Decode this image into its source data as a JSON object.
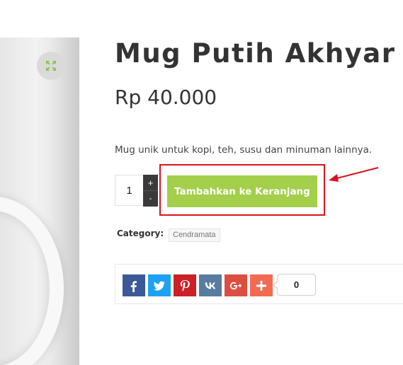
{
  "product": {
    "title": "Mug Putih Akhyar",
    "price": "Rp 40.000",
    "description": "Mug unik untuk kopi, teh, susu dan minuman lainnya.",
    "zoom_icon": "expand-icon"
  },
  "cart": {
    "quantity": "1",
    "increment_label": "+",
    "decrement_label": "-",
    "add_to_cart_label": "Tambahkan ke Keranjang"
  },
  "meta": {
    "category_label": "Category:",
    "category_value": "Cendramata"
  },
  "share": {
    "buttons": [
      {
        "network": "facebook",
        "icon": "facebook-icon",
        "color": "#3b5998"
      },
      {
        "network": "twitter",
        "icon": "twitter-icon",
        "color": "#1da1f2"
      },
      {
        "network": "pinterest",
        "icon": "pinterest-icon",
        "color": "#cb2027"
      },
      {
        "network": "vk",
        "icon": "vk-icon",
        "color": "#587ba0"
      },
      {
        "network": "google-plus",
        "icon": "google-plus-icon",
        "color": "#dc4e41"
      },
      {
        "network": "addthis",
        "icon": "plus-icon",
        "color": "#f26a52"
      }
    ],
    "count": "0"
  },
  "colors": {
    "accent": "#a3cf4a",
    "annotation": "#d7141a"
  }
}
